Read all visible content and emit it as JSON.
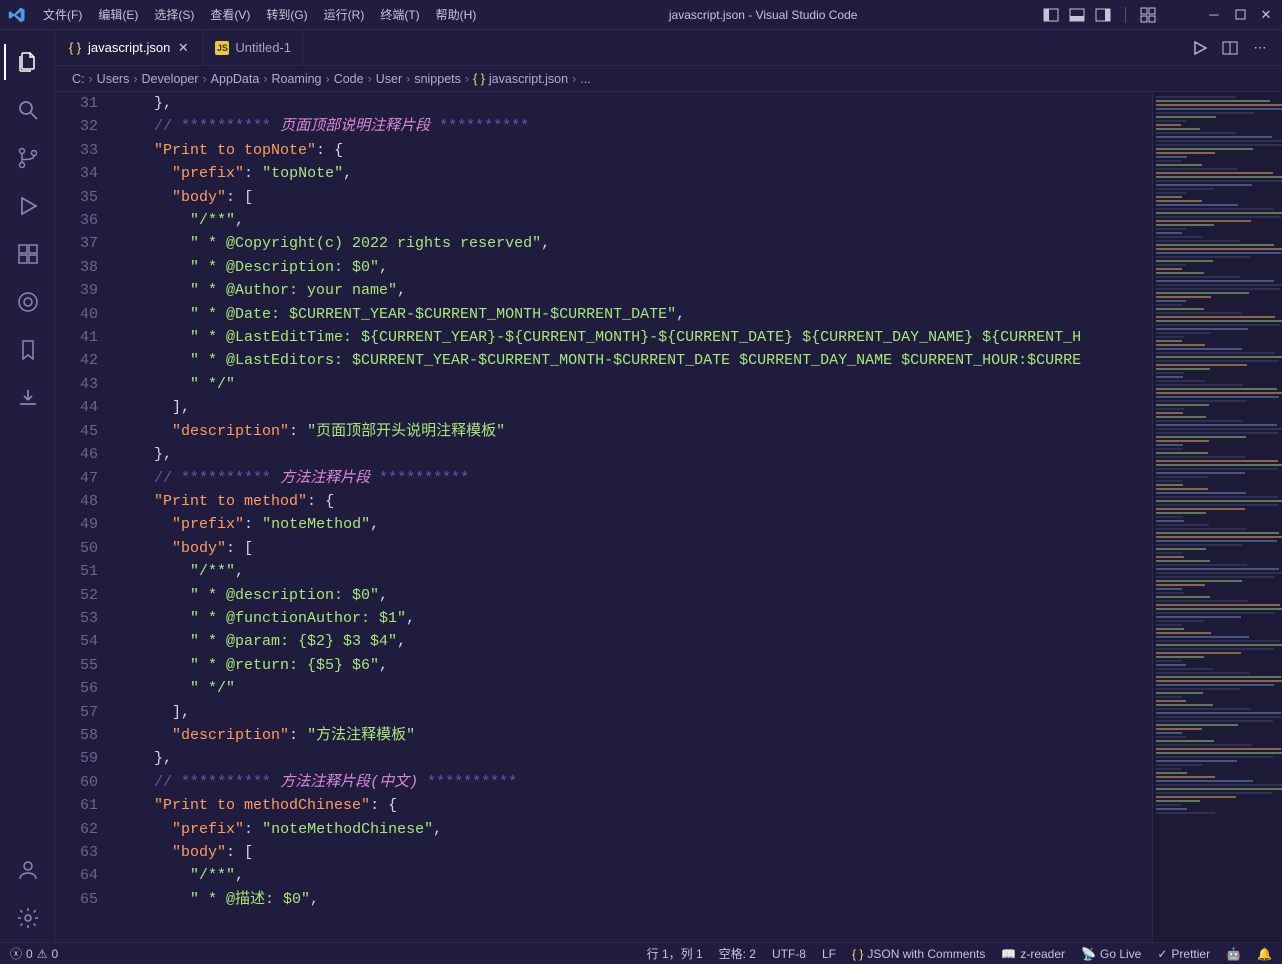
{
  "window": {
    "title": "javascript.json - Visual Studio Code"
  },
  "menu": {
    "file": "文件(F)",
    "edit": "编辑(E)",
    "select": "选择(S)",
    "view": "查看(V)",
    "goto": "转到(G)",
    "run": "运行(R)",
    "terminal": "终端(T)",
    "help": "帮助(H)"
  },
  "tabs": {
    "t1": "javascript.json",
    "t2": "Untitled-1"
  },
  "breadcrumb": {
    "p0": "C:",
    "p1": "Users",
    "p2": "Developer",
    "p3": "AppData",
    "p4": "Roaming",
    "p5": "Code",
    "p6": "User",
    "p7": "snippets",
    "p8": "javascript.json",
    "p9": "..."
  },
  "lines": {
    "31": {
      "num": "31",
      "indent": "    ",
      "html": "<span class='tok-punc'>},</span>"
    },
    "32": {
      "num": "32",
      "indent": "    ",
      "html": "<span class='tok-comment2'>//</span> <span class='tok-comment2'>**********</span> <span class='tok-comment'>页面顶部说明注释片段</span> <span class='tok-comment2'>**********</span>"
    },
    "33": {
      "num": "33",
      "indent": "    ",
      "html": "<span class='tok-key'>\"Print to topNote\"</span><span class='tok-punc'>:</span> <span class='tok-punc'>{</span>"
    },
    "34": {
      "num": "34",
      "indent": "      ",
      "html": "<span class='tok-key'>\"prefix\"</span><span class='tok-punc'>:</span> <span class='tok-str'>\"topNote\"</span><span class='tok-punc'>,</span>"
    },
    "35": {
      "num": "35",
      "indent": "      ",
      "html": "<span class='tok-key'>\"body\"</span><span class='tok-punc'>:</span> <span class='tok-punc'>[</span>"
    },
    "36": {
      "num": "36",
      "indent": "        ",
      "html": "<span class='tok-str'>\"/**\"</span><span class='tok-punc'>,</span>"
    },
    "37": {
      "num": "37",
      "indent": "        ",
      "html": "<span class='tok-str'>\" * @Copyright(c) 2022 rights reserved\"</span><span class='tok-punc'>,</span>"
    },
    "38": {
      "num": "38",
      "indent": "        ",
      "html": "<span class='tok-str'>\" * @Description: $0\"</span><span class='tok-punc'>,</span>"
    },
    "39": {
      "num": "39",
      "indent": "        ",
      "html": "<span class='tok-str'>\" * @Author: your name\"</span><span class='tok-punc'>,</span>"
    },
    "40": {
      "num": "40",
      "indent": "        ",
      "html": "<span class='tok-str'>\" * @Date: $CURRENT_YEAR-$CURRENT_MONTH-$CURRENT_DATE\"</span><span class='tok-punc'>,</span>"
    },
    "41": {
      "num": "41",
      "indent": "        ",
      "html": "<span class='tok-str'>\" * @LastEditTime: ${CURRENT_YEAR}-${CURRENT_MONTH}-${CURRENT_DATE} ${CURRENT_DAY_NAME} ${CURRENT_H</span>"
    },
    "42": {
      "num": "42",
      "indent": "        ",
      "html": "<span class='tok-str'>\" * @LastEditors: $CURRENT_YEAR-$CURRENT_MONTH-$CURRENT_DATE $CURRENT_DAY_NAME $CURRENT_HOUR:$CURRE</span>"
    },
    "43": {
      "num": "43",
      "indent": "        ",
      "html": "<span class='tok-str'>\" */\"</span>"
    },
    "44": {
      "num": "44",
      "indent": "      ",
      "html": "<span class='tok-punc'>],</span>"
    },
    "45": {
      "num": "45",
      "indent": "      ",
      "html": "<span class='tok-key'>\"description\"</span><span class='tok-punc'>:</span> <span class='tok-str'>\"页面顶部开头说明注释模板\"</span>"
    },
    "46": {
      "num": "46",
      "indent": "    ",
      "html": "<span class='tok-punc'>},</span>"
    },
    "47": {
      "num": "47",
      "indent": "    ",
      "html": "<span class='tok-comment2'>//</span> <span class='tok-comment2'>**********</span> <span class='tok-comment'>方法注释片段</span> <span class='tok-comment2'>**********</span>"
    },
    "48": {
      "num": "48",
      "indent": "    ",
      "html": "<span class='tok-key'>\"Print to method\"</span><span class='tok-punc'>:</span> <span class='tok-punc'>{</span>"
    },
    "49": {
      "num": "49",
      "indent": "      ",
      "html": "<span class='tok-key'>\"prefix\"</span><span class='tok-punc'>:</span> <span class='tok-str'>\"noteMethod\"</span><span class='tok-punc'>,</span>"
    },
    "50": {
      "num": "50",
      "indent": "      ",
      "html": "<span class='tok-key'>\"body\"</span><span class='tok-punc'>:</span> <span class='tok-punc'>[</span>"
    },
    "51": {
      "num": "51",
      "indent": "        ",
      "html": "<span class='tok-str'>\"/**\"</span><span class='tok-punc'>,</span>"
    },
    "52": {
      "num": "52",
      "indent": "        ",
      "html": "<span class='tok-str'>\" * @description: $0\"</span><span class='tok-punc'>,</span>"
    },
    "53": {
      "num": "53",
      "indent": "        ",
      "html": "<span class='tok-str'>\" * @functionAuthor: $1\"</span><span class='tok-punc'>,</span>"
    },
    "54": {
      "num": "54",
      "indent": "        ",
      "html": "<span class='tok-str'>\" * @param: {$2} $3 $4\"</span><span class='tok-punc'>,</span>"
    },
    "55": {
      "num": "55",
      "indent": "        ",
      "html": "<span class='tok-str'>\" * @return: {$5} $6\"</span><span class='tok-punc'>,</span>"
    },
    "56": {
      "num": "56",
      "indent": "        ",
      "html": "<span class='tok-str'>\" */\"</span>"
    },
    "57": {
      "num": "57",
      "indent": "      ",
      "html": "<span class='tok-punc'>],</span>"
    },
    "58": {
      "num": "58",
      "indent": "      ",
      "html": "<span class='tok-key'>\"description\"</span><span class='tok-punc'>:</span> <span class='tok-str'>\"方法注释模板\"</span>"
    },
    "59": {
      "num": "59",
      "indent": "    ",
      "html": "<span class='tok-punc'>},</span>"
    },
    "60": {
      "num": "60",
      "indent": "    ",
      "html": "<span class='tok-comment2'>//</span> <span class='tok-comment2'>**********</span> <span class='tok-comment'>方法注释片段(中文)</span> <span class='tok-comment2'>**********</span>"
    },
    "61": {
      "num": "61",
      "indent": "    ",
      "html": "<span class='tok-key'>\"Print to methodChinese\"</span><span class='tok-punc'>:</span> <span class='tok-punc'>{</span>"
    },
    "62": {
      "num": "62",
      "indent": "      ",
      "html": "<span class='tok-key'>\"prefix\"</span><span class='tok-punc'>:</span> <span class='tok-str'>\"noteMethodChinese\"</span><span class='tok-punc'>,</span>"
    },
    "63": {
      "num": "63",
      "indent": "      ",
      "html": "<span class='tok-key'>\"body\"</span><span class='tok-punc'>:</span> <span class='tok-punc'>[</span>"
    },
    "64": {
      "num": "64",
      "indent": "        ",
      "html": "<span class='tok-str'>\"/**\"</span><span class='tok-punc'>,</span>"
    },
    "65": {
      "num": "65",
      "indent": "        ",
      "html": "<span class='tok-str'>\" * @描述: $0\"</span><span class='tok-punc'>,</span>"
    }
  },
  "statusbar": {
    "errors": "0",
    "warnings": "0",
    "lncol": "行 1，列 1",
    "spaces": "空格: 2",
    "encoding": "UTF-8",
    "eol": "LF",
    "lang": "JSON with Comments",
    "zreader": "z-reader",
    "golive": "Go Live",
    "prettier": "Prettier"
  }
}
